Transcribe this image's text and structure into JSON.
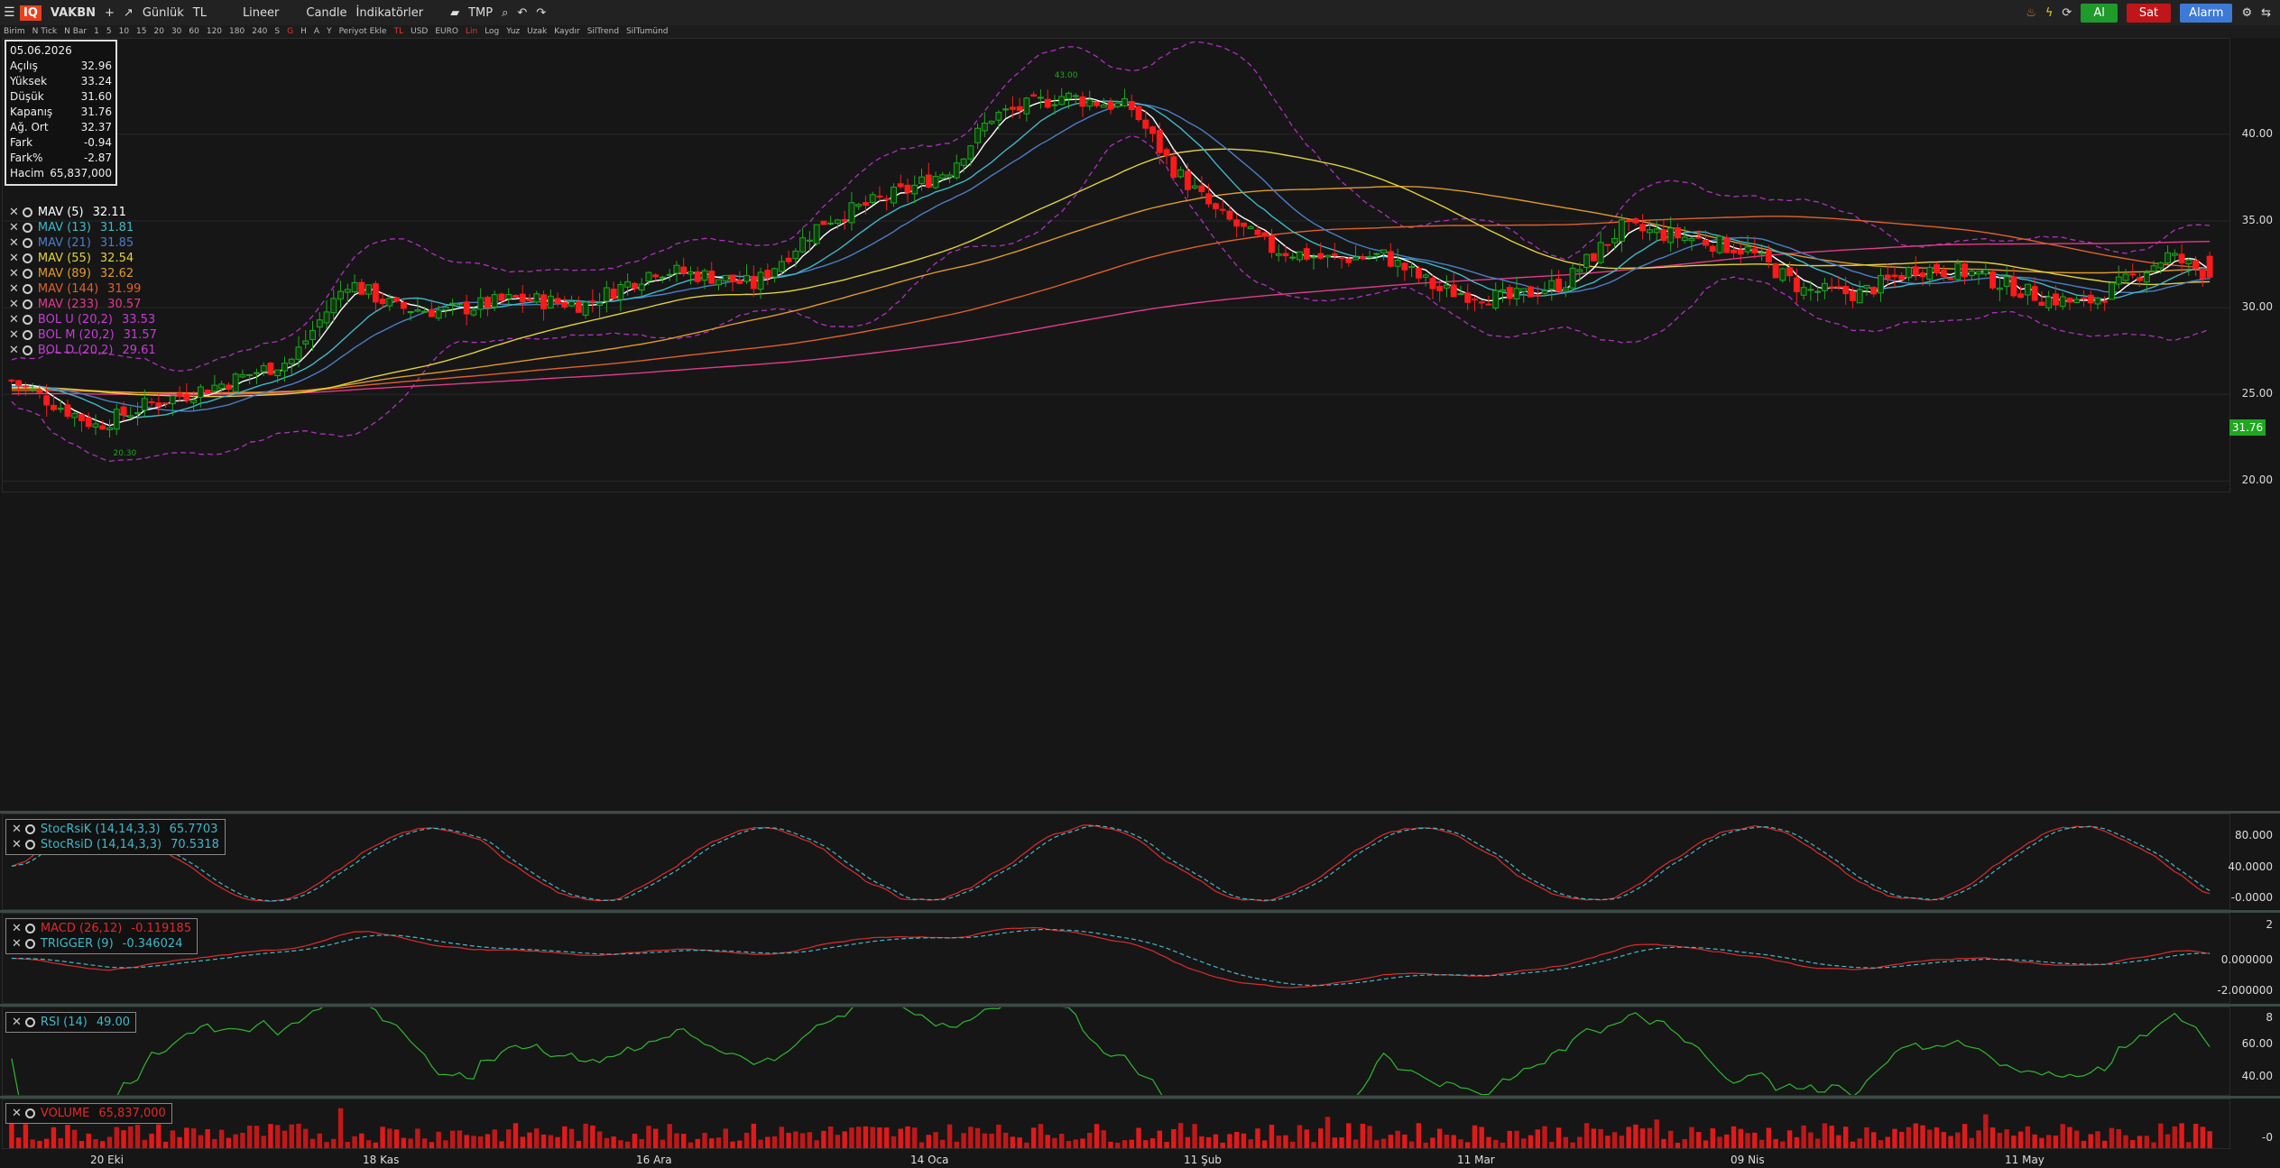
{
  "toolbar": {
    "logo": "IQ",
    "symbol": "VAKBN",
    "add": "+",
    "period": "Günlük",
    "currency": "TL",
    "scale": "Lineer",
    "chart_type": "Candle",
    "indicators": "İndikatörler",
    "template": "TMP",
    "buy": "Al",
    "sell": "Sat",
    "alarm": "Alarm"
  },
  "toolbar2": {
    "items": [
      "Birim",
      "N Tick",
      "N Bar",
      "1",
      "5",
      "10",
      "15",
      "20",
      "30",
      "60",
      "120",
      "180",
      "240",
      "S",
      "G",
      "H",
      "A",
      "Y",
      "Periyot Ekle",
      "TL",
      "USD",
      "EURO",
      "Lin",
      "Log",
      "Yuz",
      "Uzak",
      "Kaydır",
      "SilTrend",
      "SilTumünd"
    ],
    "active": [
      "G",
      "TL",
      "Lin"
    ]
  },
  "ohlc": {
    "date": "05.06.2026",
    "rows": [
      {
        "label": "Açılış",
        "value": "32.96"
      },
      {
        "label": "Yüksek",
        "value": "33.24"
      },
      {
        "label": "Düşük",
        "value": "31.60"
      },
      {
        "label": "Kapanış",
        "value": "31.76"
      },
      {
        "label": "Ağ. Ort",
        "value": "32.37"
      },
      {
        "label": "Fark",
        "value": "-0.94"
      },
      {
        "label": "Fark%",
        "value": "-2.87"
      },
      {
        "label": "Hacim",
        "value": "65,837,000"
      }
    ]
  },
  "main_legend": [
    {
      "name": "MAV (5)",
      "value": "32.11",
      "color": "#ffffff"
    },
    {
      "name": "MAV (13)",
      "value": "31.81",
      "color": "#3fb8c8"
    },
    {
      "name": "MAV (21)",
      "value": "31.85",
      "color": "#4a7ec8"
    },
    {
      "name": "MAV (55)",
      "value": "32.54",
      "color": "#e0d23a"
    },
    {
      "name": "MAV (89)",
      "value": "32.62",
      "color": "#e09a2a"
    },
    {
      "name": "MAV (144)",
      "value": "31.99",
      "color": "#e0602a"
    },
    {
      "name": "MAV (233)",
      "value": "30.57",
      "color": "#e23a8a"
    },
    {
      "name": "BOL U (20,2)",
      "value": "33.53",
      "color": "#c83ad8"
    },
    {
      "name": "BOL M (20,2)",
      "value": "31.57",
      "color": "#c83ad8"
    },
    {
      "name": "BOL D (20,2)",
      "value": "29.61",
      "color": "#c83ad8"
    }
  ],
  "stoch_legend": [
    {
      "name": "StocRsiK (14,14,3,3)",
      "value": "65.7703",
      "color": "#3fb8c8"
    },
    {
      "name": "StocRsiD (14,14,3,3)",
      "value": "70.5318",
      "color": "#3fb8c8"
    }
  ],
  "macd_legend": [
    {
      "name": "MACD (26,12)",
      "value": "-0.119185",
      "color": "#e02a2a"
    },
    {
      "name": "TRIGGER (9)",
      "value": "-0.346024",
      "color": "#3fb8c8"
    }
  ],
  "rsi_legend": [
    {
      "name": "RSI (14)",
      "value": "49.00",
      "color": "#3fb8c8"
    }
  ],
  "vol_legend": [
    {
      "name": "VOLUME",
      "value": "65,837,000",
      "color": "#e02a2a"
    }
  ],
  "axes": {
    "price_ticks": [
      "40.00",
      "35.00",
      "30.00",
      "25.00",
      "20.00"
    ],
    "last_price": "31.76",
    "stoch_ticks": [
      "80.000",
      "40.0000",
      "-0.0000"
    ],
    "macd_ticks": [
      "2",
      "0.000000",
      "-2.000000"
    ],
    "rsi_ticks": [
      "8",
      "60.00",
      "40.00"
    ],
    "vol_ticks": [
      "-0"
    ],
    "dates": [
      "20 Eki",
      "18 Kas",
      "16 Ara",
      "14 Oca",
      "11 Şub",
      "11 Mar",
      "09 Nis",
      "11 May"
    ],
    "high_marker": "43.00",
    "low_marker": "20.30"
  },
  "colors": {
    "up": "#1fa81f",
    "down": "#ff1a1a",
    "bg": "#161616"
  }
}
